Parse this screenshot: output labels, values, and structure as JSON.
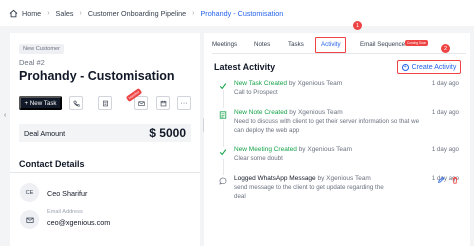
{
  "breadcrumb": {
    "items": [
      "Home",
      "Sales",
      "Customer Onboarding Pipeline",
      "Prohandy - Customisation"
    ]
  },
  "deal": {
    "badge": "New Customer",
    "number": "Deal #2",
    "title": "Prohandy - Customisation",
    "new_task_label": "+ New Task",
    "red_tag": "Inactive",
    "amount_label": "Deal Amount",
    "amount_value": "$ 5000"
  },
  "contact": {
    "heading": "Contact Details",
    "initials": "CE",
    "name": "Ceo Sharifur",
    "email_label": "Email Address",
    "email_value": "ceo@xgenious.com"
  },
  "tabs": {
    "items": [
      "Meetings",
      "Notes",
      "Tasks",
      "Activity",
      "Email Sequence"
    ],
    "active": "Activity",
    "coming_soon": "Coming Soon",
    "marker1": "1",
    "marker2": "2"
  },
  "activity": {
    "heading": "Latest Activity",
    "create_label": "Create Activity",
    "items": [
      {
        "title": "New Task Created",
        "by": "by Xgenious Team",
        "desc1": "Call to Prospect",
        "desc2": "",
        "time": "1 day ago"
      },
      {
        "title": "New Note Created",
        "by": "by Xgenious Team",
        "desc1": "Need to discuss with client to get their server information so that we",
        "desc2": "can deploy the web app",
        "time": "1 day ago"
      },
      {
        "title": "New Meeting Created",
        "by": "by Xgenious Team",
        "desc1": "Clear some doubt",
        "desc2": "",
        "time": "1 day ago"
      },
      {
        "title": "Logged WhatsApp Message",
        "by": "by Xgenious Team",
        "desc1": "send message to the client to get update regarding the",
        "desc2": "deal",
        "time": "1 day ago"
      }
    ]
  },
  "colors": {
    "accent": "#2563eb",
    "highlight": "#ef4444",
    "success": "#16a34a",
    "dark_button": "#111827"
  }
}
